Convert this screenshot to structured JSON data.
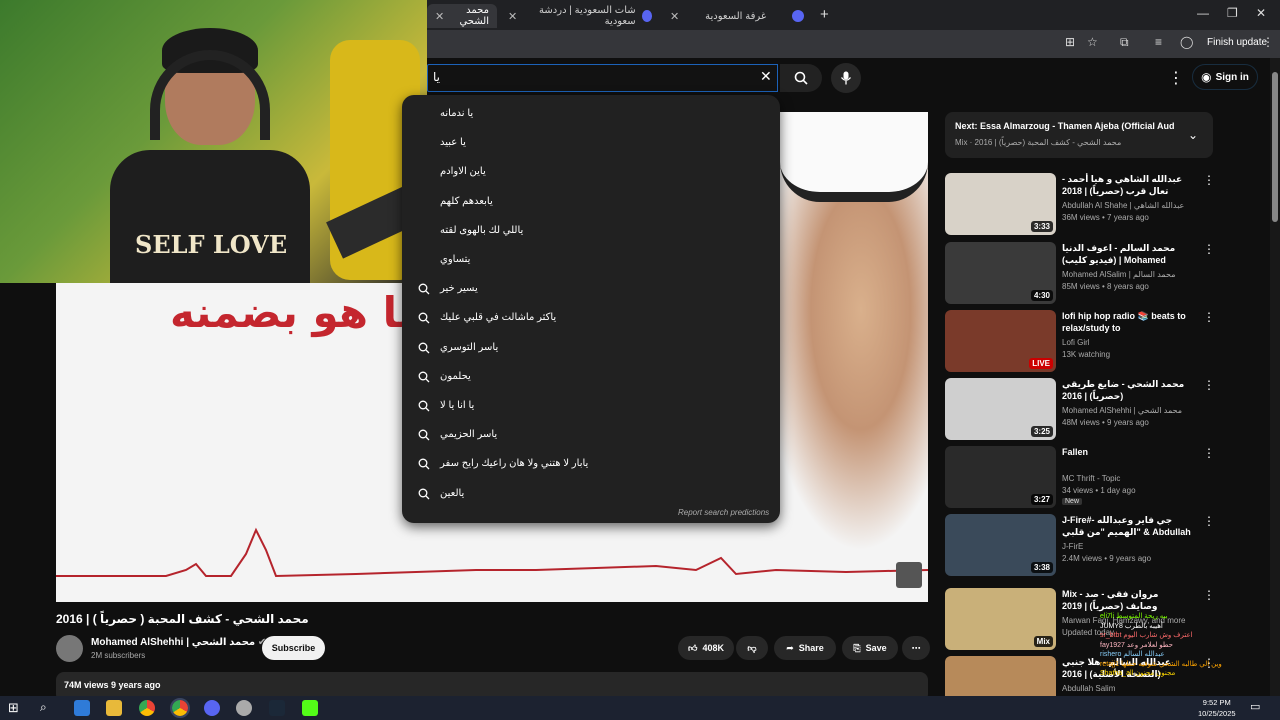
{
  "browser": {
    "tabs": [
      {
        "label": "محمد الشحي",
        "active": true
      },
      {
        "label": "شات السعودية | دردشة سعودية"
      },
      {
        "label": "غرفة السعودية"
      }
    ],
    "finish_update": "Finish update"
  },
  "search": {
    "query": "يا",
    "suggestions": [
      "يا ندمانه",
      "يا عبيد",
      "ياين الاوادم",
      "يابعدهم كلهم",
      "ياللي لك بالهوى لقته",
      "يتساوي",
      "يسير خير",
      "ياكثر ماشالت في قلبي عليك",
      "ياسر التوسري",
      "يحلمون",
      "يا انا يا لا",
      "ياسر الحزيمي",
      "يابار لا هتني ولا هان راعيك رايح سفر",
      "يالعين"
    ],
    "report": "Report search predictions"
  },
  "masthead": {
    "signin": "Sign in"
  },
  "player": {
    "lyric": "ما هو بضمنه"
  },
  "video": {
    "title": "محمد الشحي - كشف المحبة ( حصرياً ) | 2016",
    "channel": "Mohamed AlShehhi | محمد الشحي",
    "subscribers": "2M subscribers",
    "subscribe": "Subscribe",
    "likes": "408K",
    "share": "Share",
    "save": "Save",
    "views_line": "74M views  9 years ago"
  },
  "next": {
    "title": "Next: Essa Almarzoug - Thamen Ajeba (Official Aud...",
    "sub": "Mix · 2016 | محمد الشحي - كشف المحبة (حصرياً)"
  },
  "recommendations": [
    {
      "title": "عبدالله الشاهي و هيا أحمد - تعال قرب (حصرياً) | 2018",
      "channel": "Abdullah Al Shahe | عبدالله الشاهي",
      "meta": "36M views • 7 years ago",
      "duration": "3:33",
      "color": "#d8d2c8"
    },
    {
      "title": "محمد السالم - اعوف الدنيا (فيديو كليب) | Mohamed Aslalim -) | 2017 ...",
      "channel": "Mohamed AlSalim | محمد السالم",
      "meta": "85M views • 8 years ago",
      "duration": "4:30",
      "color": "#3a3a3a"
    },
    {
      "title": "lofi hip hop radio 📚 beats to relax/study to",
      "channel": "Lofi Girl",
      "meta": "13K watching",
      "duration": "LIVE",
      "live": true,
      "color": "#7a3a2a"
    },
    {
      "title": "محمد الشحي - ضايع طريقي (حصرياً) | 2016",
      "channel": "Mohamed AlShehhi | محمد الشحي",
      "meta": "48M views • 9 years ago",
      "duration": "3:25",
      "color": "#cfcfcf"
    },
    {
      "title": "Fallen",
      "channel": "MC Thrift - Topic",
      "meta": "34 views • 1 day ago",
      "badge": "New",
      "duration": "3:27",
      "color": "#2a2a2a"
    },
    {
      "title": "J-Fire#- جي فاير وعبدالله الهميم \"من قلبي\" & Abdullah alhamem - Mn Qalby",
      "channel": "J-FirE",
      "meta": "2.4M views • 9 years ago",
      "duration": "3:38",
      "color": "#3a4a5a"
    },
    {
      "title": "Mix - مروان فقي - صد وصايف (حصرياً) | 2019",
      "channel": "Marwan Fagi, Hamzawy, and more",
      "meta": "Updated today",
      "duration": "Mix",
      "color": "#c9b079"
    },
    {
      "title": "عبدالله السالم - هلا جنبي (النسخة الأصلية) | 2016",
      "channel": "Abdullah Salim",
      "meta": "",
      "duration": "",
      "color": "#b78a5a"
    }
  ],
  "chat": [
    "eli7li  بيه ريحة المتوسط",
    "JUMY8  أهيبه بالطرب",
    "sr_btbt  اعترف وش شارب اليوم",
    "fay1927  حطو لعلامر وعد",
    "rishero  عبدالله السالم",
    "retajj1  وين الي طالبه الشحي شوفيه حطها",
    "Shatha_all  مجنون مجنون"
  ],
  "clock": {
    "time": "9:52 PM",
    "date": "10/25/2025"
  }
}
